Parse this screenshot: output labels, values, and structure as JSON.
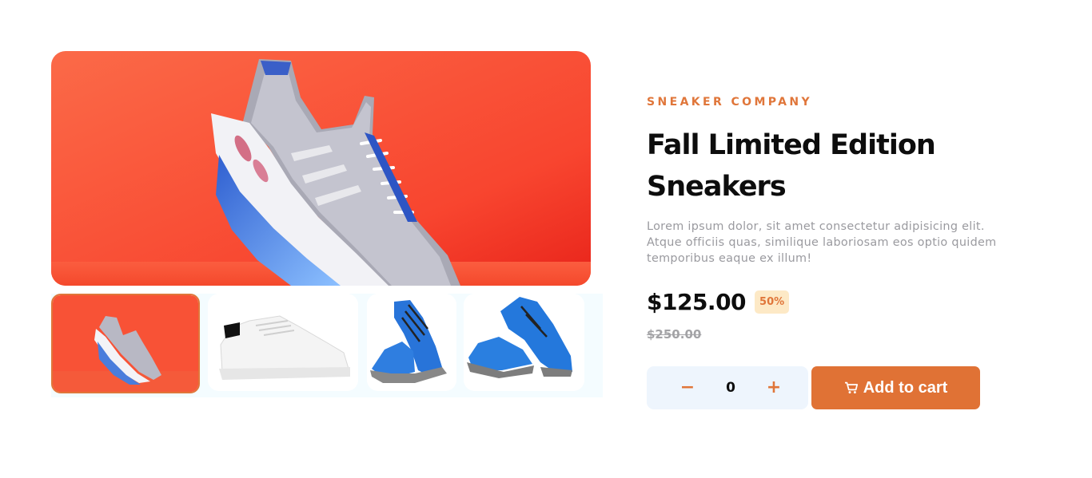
{
  "product": {
    "company": "SNEAKER COMPANY",
    "title_line1": "Fall Limited Edition",
    "title_line2": "Sneakers",
    "description": "Lorem ipsum dolor, sit amet consectetur adipisicing elit. Atque officiis quas, similique laboriosam eos optio quidem temporibus eaque ex illum!",
    "price": "$125.00",
    "discount": "50%",
    "old_price": "$250.00"
  },
  "cart": {
    "minus": "−",
    "quantity": "0",
    "plus": "+",
    "add_label": "Add to cart",
    "icon": "cart-icon"
  },
  "gallery": {
    "main": "sneaker-product-image",
    "thumbnails": [
      "sneaker-thumbnail-1",
      "sneaker-thumbnail-2",
      "sneaker-thumbnail-3",
      "sneaker-thumbnail-4"
    ]
  },
  "colors": {
    "accent": "#e0763a",
    "discount_bg": "#fde9c6",
    "qty_bg": "#eef5fd",
    "text": "#0d0d0d",
    "muted": "#9a9a9f"
  }
}
